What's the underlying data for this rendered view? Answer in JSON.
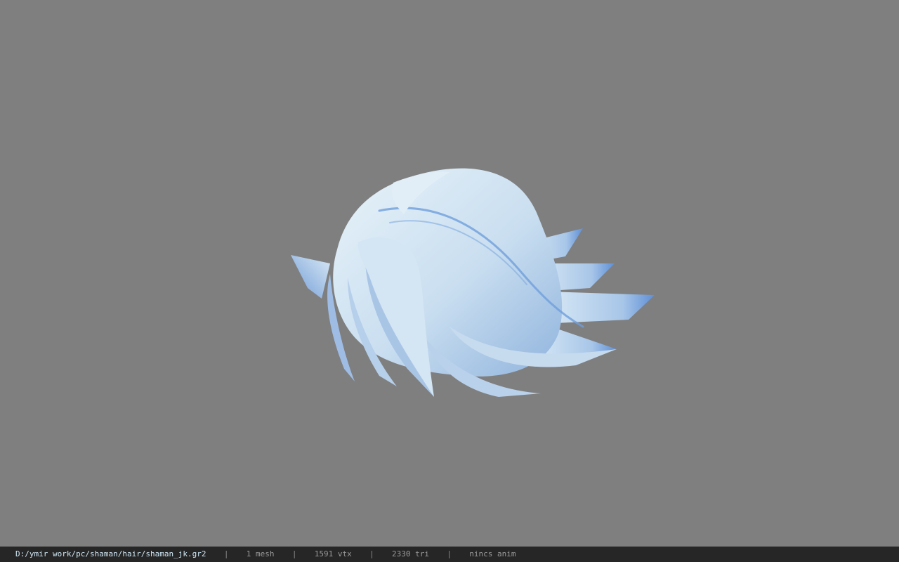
{
  "viewer": {
    "background_color": "#7f7f7f",
    "model_name": "shaman hair mesh",
    "model_colors": {
      "light": "#dcecf6",
      "mid": "#b8d2ea",
      "shadow": "#7ea6d4",
      "accent": "#4f86d8"
    }
  },
  "statusbar": {
    "file_path": "D:/ymir work/pc/shaman/hair/shaman_jk.gr2",
    "separator": "|",
    "mesh_count": "1 mesh",
    "vertex_count": "1591 vtx",
    "triangle_count": "2330 tri",
    "anim_status": "nincs anim"
  }
}
